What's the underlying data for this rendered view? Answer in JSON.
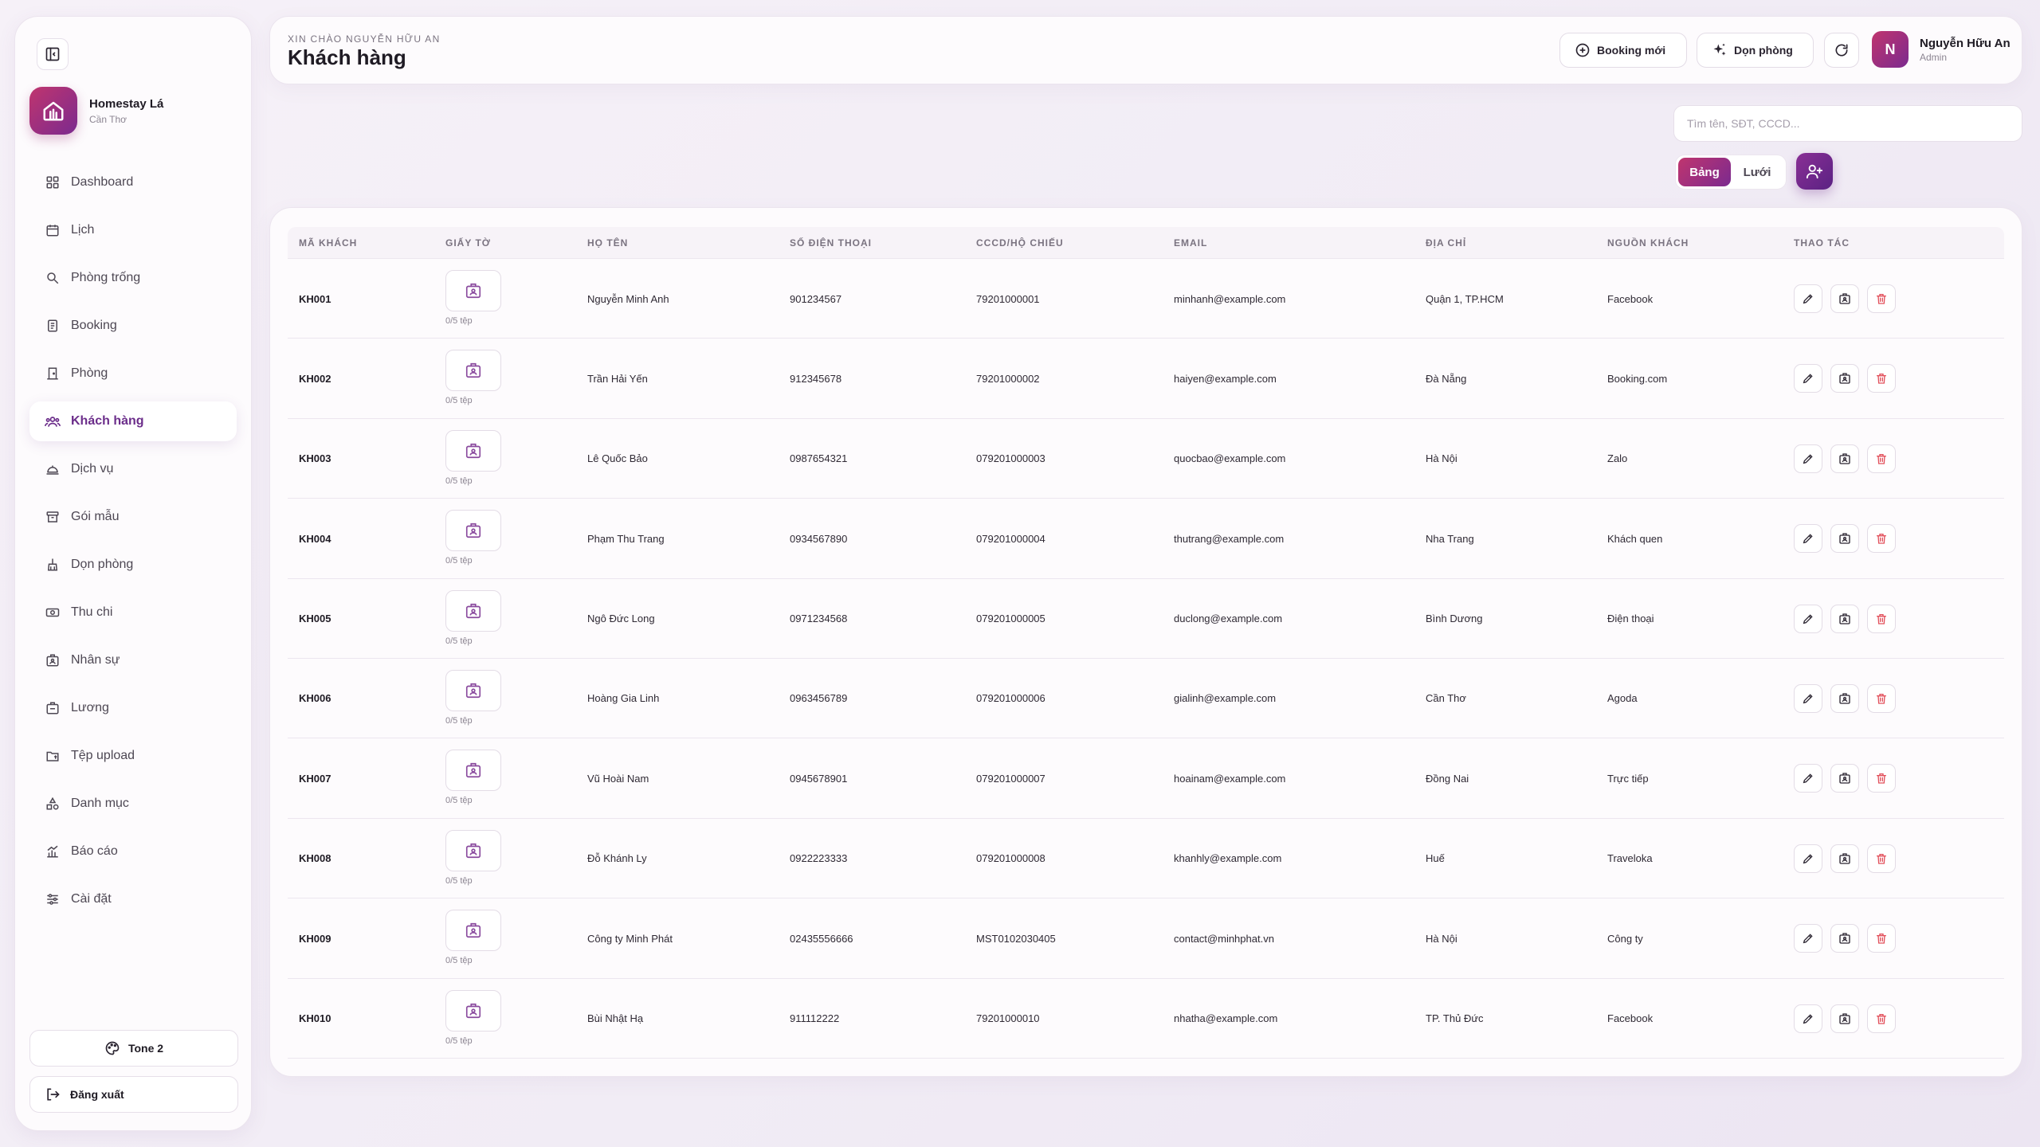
{
  "brand": {
    "name": "Homestay Lá",
    "location": "Cần Thơ"
  },
  "sidebar": {
    "items": [
      {
        "label": "Dashboard",
        "icon": "dashboard-icon"
      },
      {
        "label": "Lịch",
        "icon": "calendar-icon"
      },
      {
        "label": "Phòng trống",
        "icon": "search-icon"
      },
      {
        "label": "Booking",
        "icon": "clipboard-icon"
      },
      {
        "label": "Phòng",
        "icon": "door-icon"
      },
      {
        "label": "Khách hàng",
        "icon": "users-icon",
        "active": true
      },
      {
        "label": "Dịch vụ",
        "icon": "service-bell-icon"
      },
      {
        "label": "Gói mẫu",
        "icon": "archive-icon"
      },
      {
        "label": "Dọn phòng",
        "icon": "broom-icon"
      },
      {
        "label": "Thu chi",
        "icon": "money-icon"
      },
      {
        "label": "Nhân sự",
        "icon": "id-card-icon"
      },
      {
        "label": "Lương",
        "icon": "wallet-icon"
      },
      {
        "label": "Tệp upload",
        "icon": "folder-upload-icon"
      },
      {
        "label": "Danh mục",
        "icon": "shapes-icon"
      },
      {
        "label": "Báo cáo",
        "icon": "chart-icon"
      },
      {
        "label": "Cài đặt",
        "icon": "sliders-icon"
      }
    ],
    "tone_label": "Tone 2",
    "logout_label": "Đăng xuất"
  },
  "header": {
    "greeting": "XIN CHÀO NGUYỄN HỮU AN",
    "title": "Khách hàng",
    "booking_label": "Booking mới",
    "clean_label": "Dọn phòng",
    "user": {
      "initial": "N",
      "name": "Nguyễn Hữu An",
      "role": "Admin"
    }
  },
  "toolbar": {
    "search_placeholder": "Tìm tên, SĐT, CCCD...",
    "view_table": "Bảng",
    "view_grid": "Lưới"
  },
  "table": {
    "columns": [
      "MÃ KHÁCH",
      "GIẤY TỜ",
      "HỌ TÊN",
      "SỐ ĐIỆN THOẠI",
      "CCCD/HỘ CHIẾU",
      "EMAIL",
      "ĐỊA CHỈ",
      "NGUỒN KHÁCH",
      "THAO TÁC"
    ],
    "rows": [
      {
        "code": "KH001",
        "docs": "0/5 tệp",
        "name": "Nguyễn Minh Anh",
        "phone": "901234567",
        "id": "79201000001",
        "email": "minhanh@example.com",
        "address": "Quận 1, TP.HCM",
        "source": "Facebook"
      },
      {
        "code": "KH002",
        "docs": "0/5 tệp",
        "name": "Trần Hải Yến",
        "phone": "912345678",
        "id": "79201000002",
        "email": "haiyen@example.com",
        "address": "Đà Nẵng",
        "source": "Booking.com"
      },
      {
        "code": "KH003",
        "docs": "0/5 tệp",
        "name": "Lê Quốc Bảo",
        "phone": "0987654321",
        "id": "079201000003",
        "email": "quocbao@example.com",
        "address": "Hà Nội",
        "source": "Zalo"
      },
      {
        "code": "KH004",
        "docs": "0/5 tệp",
        "name": "Phạm Thu Trang",
        "phone": "0934567890",
        "id": "079201000004",
        "email": "thutrang@example.com",
        "address": "Nha Trang",
        "source": "Khách quen"
      },
      {
        "code": "KH005",
        "docs": "0/5 tệp",
        "name": "Ngô Đức Long",
        "phone": "0971234568",
        "id": "079201000005",
        "email": "duclong@example.com",
        "address": "Bình Dương",
        "source": "Điện thoại"
      },
      {
        "code": "KH006",
        "docs": "0/5 tệp",
        "name": "Hoàng Gia Linh",
        "phone": "0963456789",
        "id": "079201000006",
        "email": "gialinh@example.com",
        "address": "Cần Thơ",
        "source": "Agoda"
      },
      {
        "code": "KH007",
        "docs": "0/5 tệp",
        "name": "Vũ Hoài Nam",
        "phone": "0945678901",
        "id": "079201000007",
        "email": "hoainam@example.com",
        "address": "Đồng Nai",
        "source": "Trực tiếp"
      },
      {
        "code": "KH008",
        "docs": "0/5 tệp",
        "name": "Đỗ Khánh Ly",
        "phone": "0922223333",
        "id": "079201000008",
        "email": "khanhly@example.com",
        "address": "Huế",
        "source": "Traveloka"
      },
      {
        "code": "KH009",
        "docs": "0/5 tệp",
        "name": "Công ty Minh Phát",
        "phone": "02435556666",
        "id": "MST0102030405",
        "email": "contact@minhphat.vn",
        "address": "Hà Nội",
        "source": "Công ty"
      },
      {
        "code": "KH010",
        "docs": "0/5 tệp",
        "name": "Bùi Nhật Hạ",
        "phone": "911112222",
        "id": "79201000010",
        "email": "nhatha@example.com",
        "address": "TP. Thủ Đức",
        "source": "Facebook"
      }
    ]
  },
  "colors": {
    "accent_start": "#c0356e",
    "accent_end": "#7b2a8f",
    "delete": "#e2505b",
    "icon": "#4d4753"
  }
}
